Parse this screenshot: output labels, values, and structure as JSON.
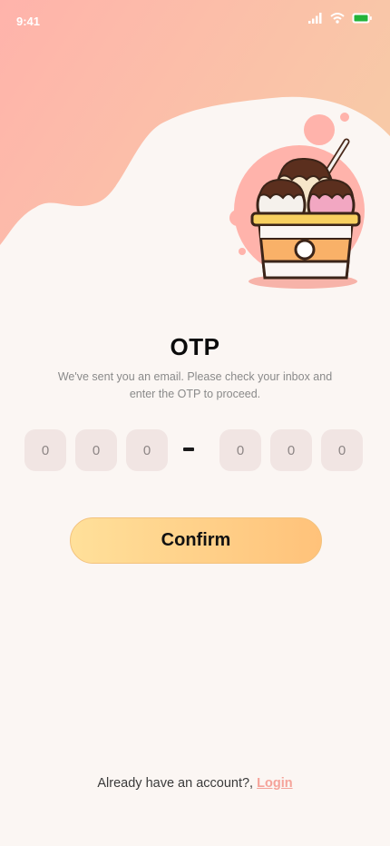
{
  "status_bar": {
    "time": "9:41",
    "icons": [
      "signal-icon",
      "wifi-icon",
      "battery-icon"
    ]
  },
  "screen": {
    "title": "OTP",
    "subtitle": "We've sent you an email. Please check your inbox and enter the OTP to proceed.",
    "illustration": "ice-cream-cup-illustration"
  },
  "otp": {
    "digits": [
      "0",
      "0",
      "0",
      "0",
      "0",
      "0"
    ]
  },
  "actions": {
    "confirm_label": "Confirm"
  },
  "footer": {
    "prompt": "Already have an account?,",
    "login_label": "Login"
  },
  "colors": {
    "background": "#fbf6f3",
    "blob_start": "#ffb3ab",
    "blob_end": "#f8c9a7",
    "button_start": "#ffe09a",
    "button_end": "#ffc27a",
    "otp_box": "#f1e5e3",
    "link": "#f5a39a",
    "battery": "#22b33a"
  }
}
